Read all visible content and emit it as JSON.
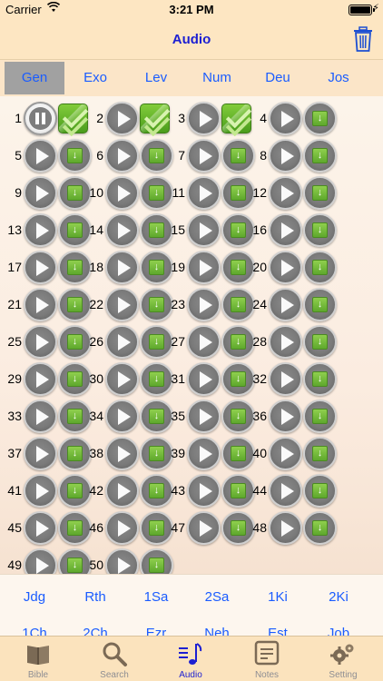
{
  "status": {
    "carrier": "Carrier",
    "time": "3:21 PM",
    "battery_level": 1.0
  },
  "nav": {
    "title": "Audio",
    "trash_icon": "trash-icon"
  },
  "books_top": [
    "Gen",
    "Exo",
    "Lev",
    "Num",
    "Deu",
    "Jos"
  ],
  "active_book": "Gen",
  "chapters": [
    "1",
    "2",
    "3",
    "4",
    "5",
    "6",
    "7",
    "8",
    "9",
    "10",
    "11",
    "12",
    "13",
    "14",
    "15",
    "16",
    "17",
    "18",
    "19",
    "20",
    "21",
    "22",
    "23",
    "24",
    "25",
    "26",
    "27",
    "28",
    "29",
    "30",
    "31",
    "32",
    "33",
    "34",
    "35",
    "36",
    "37",
    "38",
    "39",
    "40",
    "41",
    "42",
    "43",
    "44",
    "45",
    "46",
    "47",
    "48",
    "49",
    "50"
  ],
  "chapter_status": {
    "playing": [
      "1"
    ],
    "downloaded": [
      "1",
      "2",
      "3"
    ]
  },
  "books_row2": [
    "Jdg",
    "Rth",
    "1Sa",
    "2Sa",
    "1Ki",
    "2Ki"
  ],
  "books_row3": [
    "1Ch",
    "2Ch",
    "Ezr",
    "Neh",
    "Est",
    "Job"
  ],
  "tabs": [
    {
      "label": "Bible",
      "icon": "book-icon"
    },
    {
      "label": "Search",
      "icon": "magnifier-icon"
    },
    {
      "label": "Audio",
      "icon": "music-note-icon"
    },
    {
      "label": "Notes",
      "icon": "notes-icon"
    },
    {
      "label": "Setting",
      "icon": "gear-icon"
    }
  ],
  "active_tab": "Audio",
  "colors": {
    "accent": "#1c1fd2",
    "link": "#1a5cff",
    "bar": "#fde6c2",
    "download_green": "#5ea82d"
  }
}
